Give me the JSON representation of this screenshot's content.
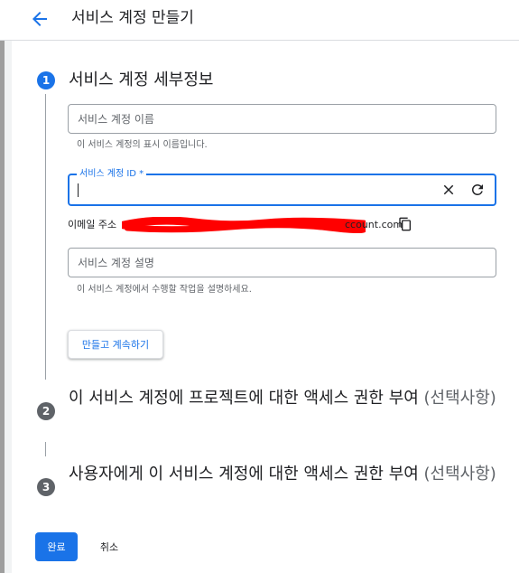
{
  "header": {
    "title": "서비스 계정 만들기",
    "back_icon": "arrow-back-icon"
  },
  "steps": [
    {
      "number": "1",
      "title": "서비스 계정 세부정보",
      "optional": ""
    },
    {
      "number": "2",
      "title": "이 서비스 계정에 프로젝트에 대한 액세스 권한 부여 ",
      "optional": "(선택사항)"
    },
    {
      "number": "3",
      "title": "사용자에게 이 서비스 계정에 대한 액세스 권한 부여 ",
      "optional": "(선택사항)"
    }
  ],
  "form": {
    "name_field": {
      "placeholder": "서비스 계정 이름",
      "value": "",
      "hint": "이 서비스 계정의 표시 이름입니다."
    },
    "id_field": {
      "label": "서비스 계정 ID *",
      "value": ""
    },
    "email": {
      "prefix": "이메일 주소",
      "suffix": "ccount.com"
    },
    "description_field": {
      "placeholder": "서비스 계정 설명",
      "value": "",
      "hint": "이 서비스 계정에서 수행할 작업을 설명하세요."
    },
    "create_button": "만들고 계속하기"
  },
  "footer": {
    "done_button": "완료",
    "cancel_button": "취소"
  },
  "colors": {
    "accent": "#1a73e8",
    "redaction": "#ff0000"
  }
}
